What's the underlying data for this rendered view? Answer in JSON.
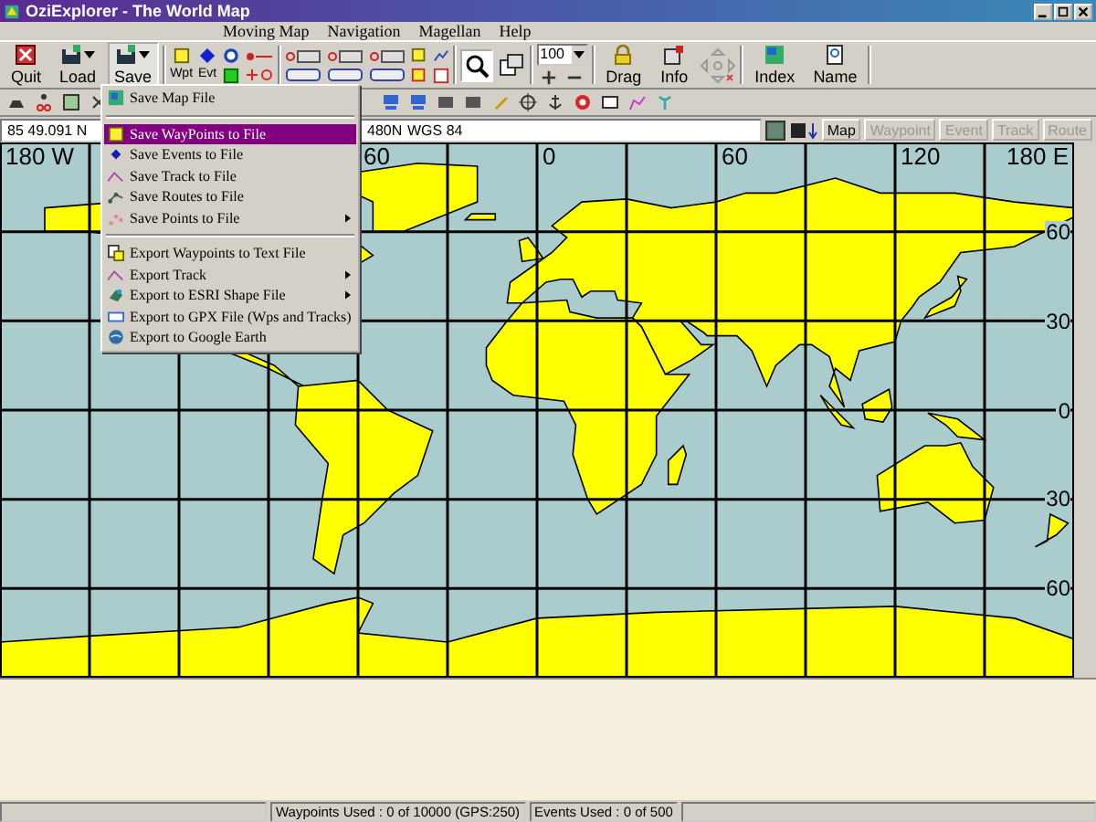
{
  "window": {
    "title": "OziExplorer - The World Map"
  },
  "menu_bar": [
    "Moving Map",
    "Navigation",
    "Magellan",
    "Help"
  ],
  "toolbar": {
    "buttons": [
      {
        "label": "Quit",
        "pressed": false,
        "dropdown": false
      },
      {
        "label": "Load",
        "pressed": false,
        "dropdown": true
      },
      {
        "label": "Save",
        "pressed": true,
        "dropdown": true
      },
      {
        "label": "Drag",
        "pressed": false,
        "dropdown": false
      },
      {
        "label": "Info",
        "pressed": false,
        "dropdown": false
      },
      {
        "label": "Index",
        "pressed": false,
        "dropdown": false
      },
      {
        "label": "Name",
        "pressed": false,
        "dropdown": false
      }
    ],
    "small_labels": [
      "Wpt",
      "Evt"
    ],
    "zoom": "100"
  },
  "position_bar": {
    "latitude": "85 49.091 N",
    "coordinate": "480N",
    "datum": "WGS 84",
    "buttons": [
      {
        "label": "Map",
        "disabled": false
      },
      {
        "label": "Waypoint",
        "disabled": true
      },
      {
        "label": "Event",
        "disabled": true
      },
      {
        "label": "Track",
        "disabled": true
      },
      {
        "label": "Route",
        "disabled": true
      }
    ]
  },
  "save_menu": [
    {
      "kind": "item",
      "label": "Save Map File",
      "selected": false,
      "submenu": false
    },
    {
      "kind": "separator"
    },
    {
      "kind": "item",
      "label": "Save WayPoints to File",
      "selected": true,
      "submenu": false
    },
    {
      "kind": "item",
      "label": "Save Events to File",
      "selected": false,
      "submenu": false
    },
    {
      "kind": "item",
      "label": "Save Track to File",
      "selected": false,
      "submenu": false
    },
    {
      "kind": "item",
      "label": "Save Routes to File",
      "selected": false,
      "submenu": false
    },
    {
      "kind": "item",
      "label": "Save Points to File",
      "selected": false,
      "submenu": true
    },
    {
      "kind": "separator"
    },
    {
      "kind": "item",
      "label": "Export Waypoints to Text File",
      "selected": false,
      "submenu": false
    },
    {
      "kind": "item",
      "label": "Export Track",
      "selected": false,
      "submenu": true
    },
    {
      "kind": "item",
      "label": "Export to ESRI Shape File",
      "selected": false,
      "submenu": true
    },
    {
      "kind": "item",
      "label": "Export to GPX File (Wps and Tracks)",
      "selected": false,
      "submenu": false
    },
    {
      "kind": "item",
      "label": "Export to Google Earth",
      "selected": false,
      "submenu": false
    }
  ],
  "map": {
    "top_labels": [
      "180 W",
      "60",
      "0",
      "60",
      "120",
      "180 E"
    ],
    "right_labels": [
      "60",
      "30",
      "0",
      "30",
      "60"
    ]
  },
  "status_bar": [
    "Waypoints Used : 0 of 10000  (GPS:250)",
    "Events Used : 0 of 500"
  ]
}
